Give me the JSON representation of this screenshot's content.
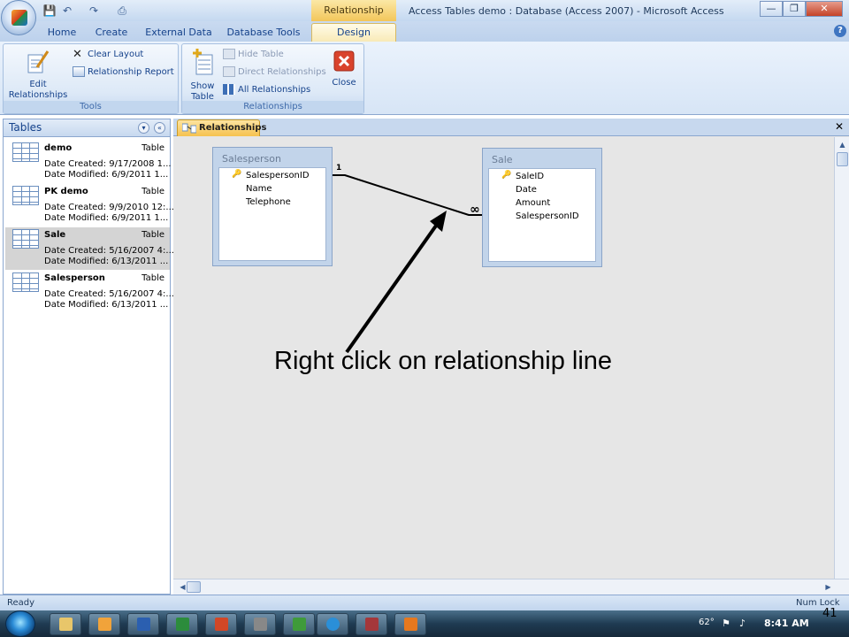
{
  "window": {
    "context_tab": "Relationship Tools",
    "title": "Access Tables demo : Database (Access 2007) - Microsoft Access",
    "min": "—",
    "max": "❐",
    "close": "✕"
  },
  "qat": {
    "save": "💾",
    "undo": "↶",
    "redo": "↷",
    "print": "⎙"
  },
  "tabs": [
    {
      "label": "Home"
    },
    {
      "label": "Create"
    },
    {
      "label": "External Data"
    },
    {
      "label": "Database Tools"
    },
    {
      "label": "Design"
    }
  ],
  "help": "?",
  "ribbon": {
    "tools": {
      "label": "Tools",
      "edit_relationships": "Edit Relationships",
      "clear_layout": "Clear Layout",
      "relationship_report": "Relationship Report"
    },
    "relationships": {
      "label": "Relationships",
      "show_table_line1": "Show",
      "show_table_line2": "Table",
      "hide_table": "Hide Table",
      "direct_relationships": "Direct Relationships",
      "all_relationships": "All Relationships",
      "close": "Close"
    }
  },
  "nav": {
    "title": "Tables",
    "dropdown": "▾",
    "collapse": "«",
    "items": [
      {
        "name": "demo",
        "type": "Table",
        "created": "Date Created: 9/17/2008 1...",
        "modified": "Date Modified: 6/9/2011 1..."
      },
      {
        "name": "PK demo",
        "type": "Table",
        "created": "Date Created: 9/9/2010 12:...",
        "modified": "Date Modified: 6/9/2011 1..."
      },
      {
        "name": "Sale",
        "type": "Table",
        "created": "Date Created: 5/16/2007 4:...",
        "modified": "Date Modified: 6/13/2011 ..."
      },
      {
        "name": "Salesperson",
        "type": "Table",
        "created": "Date Created: 5/16/2007 4:...",
        "modified": "Date Modified: 6/13/2011 ..."
      }
    ]
  },
  "document": {
    "tab_label": "Relationships",
    "close": "✕"
  },
  "diagram": {
    "salesperson": {
      "title": "Salesperson",
      "fields": [
        "SalespersonID",
        "Name",
        "Telephone"
      ]
    },
    "sale": {
      "title": "Sale",
      "fields": [
        "SaleID",
        "Date",
        "Amount",
        "SalespersonID"
      ]
    },
    "relation": {
      "one_label": "1",
      "many_label": "∞"
    }
  },
  "annotation": "Right click on relationship line",
  "status": {
    "left": "Ready",
    "right": "Num Lock"
  },
  "taskbar": {
    "temp": "62°",
    "clock": "8:41 AM"
  },
  "slide_number": "41"
}
